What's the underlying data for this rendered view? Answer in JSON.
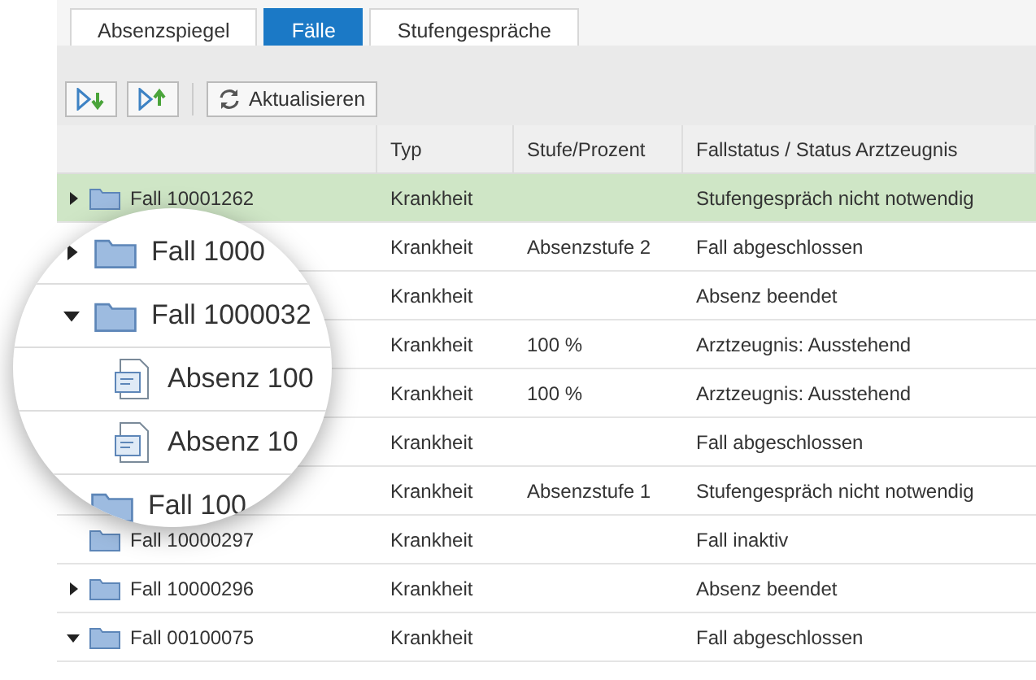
{
  "tabs": [
    {
      "label": "Absenzspiegel",
      "selected": false
    },
    {
      "label": "Fälle",
      "selected": true
    },
    {
      "label": "Stufengespräche",
      "selected": false
    }
  ],
  "toolbar": {
    "refresh_label": "Aktualisieren"
  },
  "table": {
    "columns": [
      "Typ",
      "Stufe/Prozent",
      "Fallstatus / Status Arztzeugnis"
    ],
    "rows": [
      {
        "name": "Fall 10001262",
        "expanded": false,
        "selected": true,
        "type": "Krankheit",
        "level": "",
        "status": "Stufengespräch nicht notwendig"
      },
      {
        "selected": false,
        "type": "Krankheit",
        "level": "Absenzstufe 2",
        "status": "Fall abgeschlossen"
      },
      {
        "selected": false,
        "type": "Krankheit",
        "level": "",
        "status": "Absenz beendet"
      },
      {
        "selected": false,
        "type": "Krankheit",
        "level": "100 %",
        "status": "Arztzeugnis: Ausstehend"
      },
      {
        "selected": false,
        "type": "Krankheit",
        "level": "100 %",
        "status": "Arztzeugnis: Ausstehend"
      },
      {
        "selected": false,
        "type": "Krankheit",
        "level": "",
        "status": "Fall abgeschlossen"
      },
      {
        "selected": false,
        "type": "Krankheit",
        "level": "Absenzstufe 1",
        "status": "Stufengespräch nicht notwendig"
      },
      {
        "name": "Fall 10000297",
        "selected": false,
        "type": "Krankheit",
        "level": "",
        "status": "Fall inaktiv"
      },
      {
        "name": "Fall 10000296",
        "expanded": false,
        "selected": false,
        "type": "Krankheit",
        "level": "",
        "status": "Absenz beendet"
      },
      {
        "name": "Fall 00100075",
        "expanded": true,
        "selected": false,
        "type": "Krankheit",
        "level": "",
        "status": "Fall abgeschlossen"
      }
    ]
  },
  "magnifier": {
    "rows": [
      {
        "kind": "case",
        "name": "Fall 1000",
        "expanded": false
      },
      {
        "kind": "case",
        "name": "Fall 1000032",
        "expanded": true
      },
      {
        "kind": "absence",
        "name": "Absenz 100"
      },
      {
        "kind": "absence",
        "name": "Absenz 10"
      },
      {
        "kind": "case",
        "name": "Fall 100"
      }
    ]
  }
}
